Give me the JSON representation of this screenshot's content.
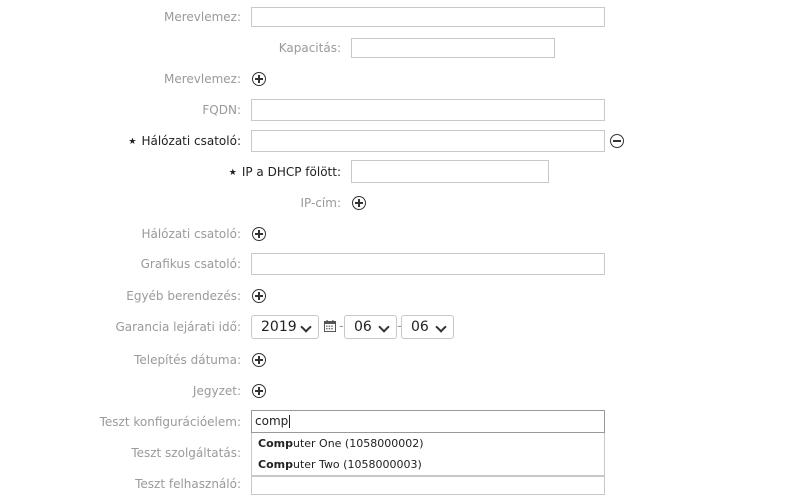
{
  "form": {
    "merevlemez_1": {
      "label": "Merevlemez:"
    },
    "kapacitas": {
      "label": "Kapacitás:"
    },
    "merevlemez_2": {
      "label": "Merevlemez:"
    },
    "fqdn": {
      "label": "FQDN:"
    },
    "halozati_csatolo_req": {
      "label": "Hálózati csatoló:",
      "required_marker": "★"
    },
    "ip_dhcp": {
      "label": "IP a DHCP fölött:",
      "required_marker": "★"
    },
    "ip_cim": {
      "label": "IP-cím:"
    },
    "halozati_csatolo": {
      "label": "Hálózati csatoló:"
    },
    "grafikus_csatolo": {
      "label": "Grafikus csatoló:"
    },
    "egyeb_berendezes": {
      "label": "Egyéb berendezés:"
    },
    "garancia": {
      "label": "Garancia lejárati idő:",
      "year": "2019",
      "month": "06",
      "day": "06",
      "separator": "-"
    },
    "telepites_datuma": {
      "label": "Telepítés dátuma:"
    },
    "jegyzet": {
      "label": "Jegyzet:"
    },
    "teszt_konfig": {
      "label": "Teszt konfigurációelem:",
      "value": "comp"
    },
    "teszt_szolgaltatas": {
      "label": "Teszt szolgáltatás:"
    },
    "teszt_felhasznalo": {
      "label": "Teszt felhasználó:"
    }
  },
  "autocomplete": {
    "items": [
      {
        "match": "Comp",
        "rest": "uter One (1058000002)"
      },
      {
        "match": "Comp",
        "rest": "uter Two (1058000003)"
      }
    ]
  },
  "icons": {
    "add": "plus-circle-icon",
    "remove": "minus-circle-icon",
    "calendar": "calendar-icon",
    "dropdown": "chevron-down-icon"
  }
}
